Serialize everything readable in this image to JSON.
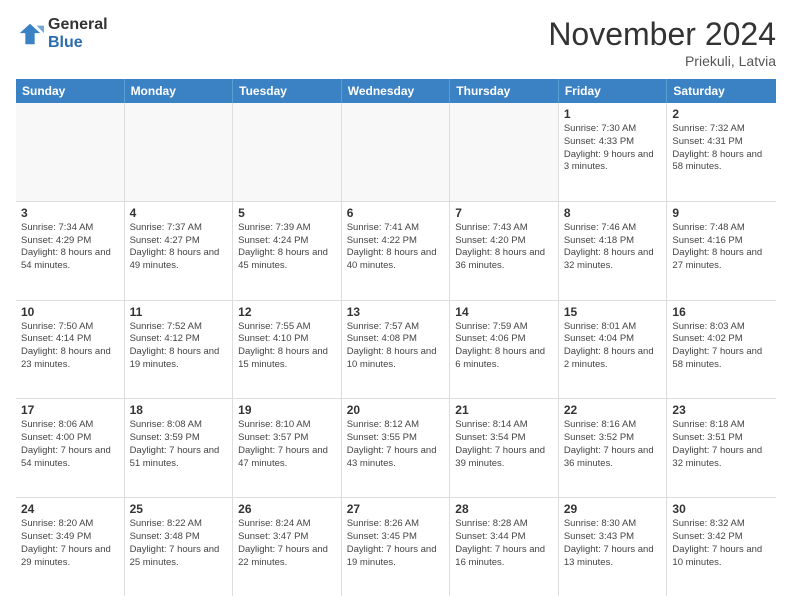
{
  "logo": {
    "general": "General",
    "blue": "Blue"
  },
  "header": {
    "month": "November 2024",
    "location": "Priekuli, Latvia"
  },
  "days_of_week": [
    "Sunday",
    "Monday",
    "Tuesday",
    "Wednesday",
    "Thursday",
    "Friday",
    "Saturday"
  ],
  "rows": [
    [
      {
        "day": "",
        "empty": true
      },
      {
        "day": "",
        "empty": true
      },
      {
        "day": "",
        "empty": true
      },
      {
        "day": "",
        "empty": true
      },
      {
        "day": "",
        "empty": true
      },
      {
        "day": "1",
        "sunrise": "Sunrise: 7:30 AM",
        "sunset": "Sunset: 4:33 PM",
        "daylight": "Daylight: 9 hours and 3 minutes."
      },
      {
        "day": "2",
        "sunrise": "Sunrise: 7:32 AM",
        "sunset": "Sunset: 4:31 PM",
        "daylight": "Daylight: 8 hours and 58 minutes."
      }
    ],
    [
      {
        "day": "3",
        "sunrise": "Sunrise: 7:34 AM",
        "sunset": "Sunset: 4:29 PM",
        "daylight": "Daylight: 8 hours and 54 minutes."
      },
      {
        "day": "4",
        "sunrise": "Sunrise: 7:37 AM",
        "sunset": "Sunset: 4:27 PM",
        "daylight": "Daylight: 8 hours and 49 minutes."
      },
      {
        "day": "5",
        "sunrise": "Sunrise: 7:39 AM",
        "sunset": "Sunset: 4:24 PM",
        "daylight": "Daylight: 8 hours and 45 minutes."
      },
      {
        "day": "6",
        "sunrise": "Sunrise: 7:41 AM",
        "sunset": "Sunset: 4:22 PM",
        "daylight": "Daylight: 8 hours and 40 minutes."
      },
      {
        "day": "7",
        "sunrise": "Sunrise: 7:43 AM",
        "sunset": "Sunset: 4:20 PM",
        "daylight": "Daylight: 8 hours and 36 minutes."
      },
      {
        "day": "8",
        "sunrise": "Sunrise: 7:46 AM",
        "sunset": "Sunset: 4:18 PM",
        "daylight": "Daylight: 8 hours and 32 minutes."
      },
      {
        "day": "9",
        "sunrise": "Sunrise: 7:48 AM",
        "sunset": "Sunset: 4:16 PM",
        "daylight": "Daylight: 8 hours and 27 minutes."
      }
    ],
    [
      {
        "day": "10",
        "sunrise": "Sunrise: 7:50 AM",
        "sunset": "Sunset: 4:14 PM",
        "daylight": "Daylight: 8 hours and 23 minutes."
      },
      {
        "day": "11",
        "sunrise": "Sunrise: 7:52 AM",
        "sunset": "Sunset: 4:12 PM",
        "daylight": "Daylight: 8 hours and 19 minutes."
      },
      {
        "day": "12",
        "sunrise": "Sunrise: 7:55 AM",
        "sunset": "Sunset: 4:10 PM",
        "daylight": "Daylight: 8 hours and 15 minutes."
      },
      {
        "day": "13",
        "sunrise": "Sunrise: 7:57 AM",
        "sunset": "Sunset: 4:08 PM",
        "daylight": "Daylight: 8 hours and 10 minutes."
      },
      {
        "day": "14",
        "sunrise": "Sunrise: 7:59 AM",
        "sunset": "Sunset: 4:06 PM",
        "daylight": "Daylight: 8 hours and 6 minutes."
      },
      {
        "day": "15",
        "sunrise": "Sunrise: 8:01 AM",
        "sunset": "Sunset: 4:04 PM",
        "daylight": "Daylight: 8 hours and 2 minutes."
      },
      {
        "day": "16",
        "sunrise": "Sunrise: 8:03 AM",
        "sunset": "Sunset: 4:02 PM",
        "daylight": "Daylight: 7 hours and 58 minutes."
      }
    ],
    [
      {
        "day": "17",
        "sunrise": "Sunrise: 8:06 AM",
        "sunset": "Sunset: 4:00 PM",
        "daylight": "Daylight: 7 hours and 54 minutes."
      },
      {
        "day": "18",
        "sunrise": "Sunrise: 8:08 AM",
        "sunset": "Sunset: 3:59 PM",
        "daylight": "Daylight: 7 hours and 51 minutes."
      },
      {
        "day": "19",
        "sunrise": "Sunrise: 8:10 AM",
        "sunset": "Sunset: 3:57 PM",
        "daylight": "Daylight: 7 hours and 47 minutes."
      },
      {
        "day": "20",
        "sunrise": "Sunrise: 8:12 AM",
        "sunset": "Sunset: 3:55 PM",
        "daylight": "Daylight: 7 hours and 43 minutes."
      },
      {
        "day": "21",
        "sunrise": "Sunrise: 8:14 AM",
        "sunset": "Sunset: 3:54 PM",
        "daylight": "Daylight: 7 hours and 39 minutes."
      },
      {
        "day": "22",
        "sunrise": "Sunrise: 8:16 AM",
        "sunset": "Sunset: 3:52 PM",
        "daylight": "Daylight: 7 hours and 36 minutes."
      },
      {
        "day": "23",
        "sunrise": "Sunrise: 8:18 AM",
        "sunset": "Sunset: 3:51 PM",
        "daylight": "Daylight: 7 hours and 32 minutes."
      }
    ],
    [
      {
        "day": "24",
        "sunrise": "Sunrise: 8:20 AM",
        "sunset": "Sunset: 3:49 PM",
        "daylight": "Daylight: 7 hours and 29 minutes."
      },
      {
        "day": "25",
        "sunrise": "Sunrise: 8:22 AM",
        "sunset": "Sunset: 3:48 PM",
        "daylight": "Daylight: 7 hours and 25 minutes."
      },
      {
        "day": "26",
        "sunrise": "Sunrise: 8:24 AM",
        "sunset": "Sunset: 3:47 PM",
        "daylight": "Daylight: 7 hours and 22 minutes."
      },
      {
        "day": "27",
        "sunrise": "Sunrise: 8:26 AM",
        "sunset": "Sunset: 3:45 PM",
        "daylight": "Daylight: 7 hours and 19 minutes."
      },
      {
        "day": "28",
        "sunrise": "Sunrise: 8:28 AM",
        "sunset": "Sunset: 3:44 PM",
        "daylight": "Daylight: 7 hours and 16 minutes."
      },
      {
        "day": "29",
        "sunrise": "Sunrise: 8:30 AM",
        "sunset": "Sunset: 3:43 PM",
        "daylight": "Daylight: 7 hours and 13 minutes."
      },
      {
        "day": "30",
        "sunrise": "Sunrise: 8:32 AM",
        "sunset": "Sunset: 3:42 PM",
        "daylight": "Daylight: 7 hours and 10 minutes."
      }
    ]
  ]
}
